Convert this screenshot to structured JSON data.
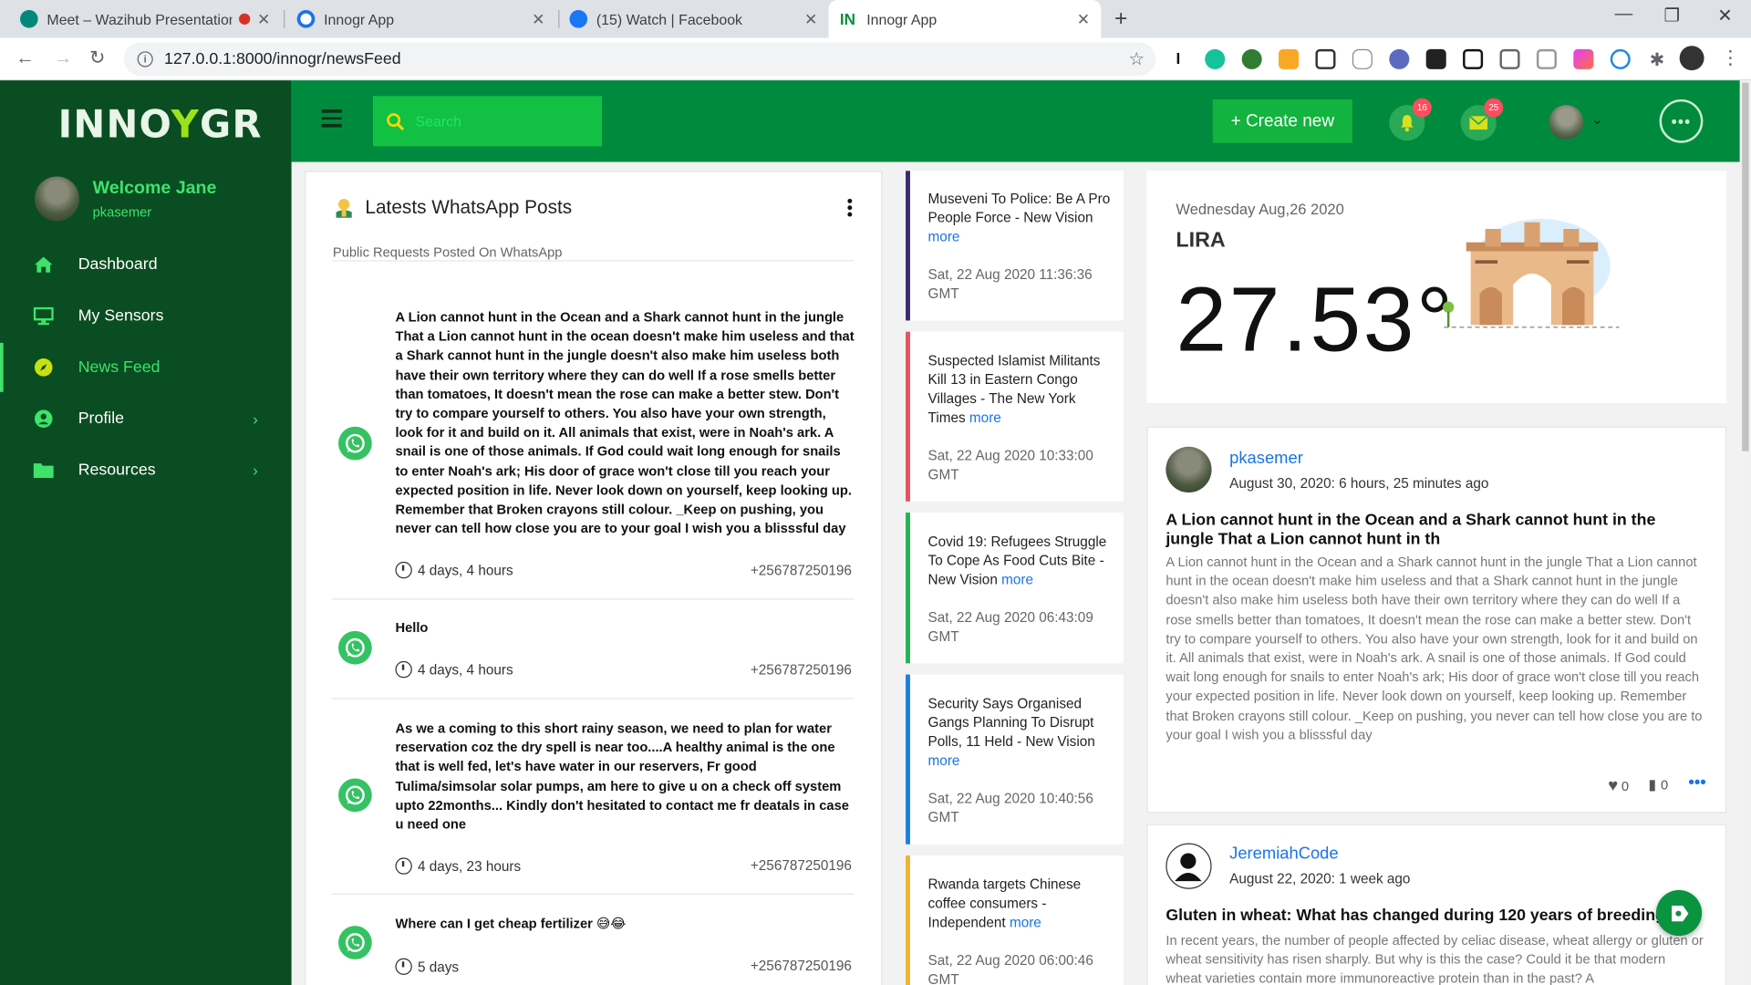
{
  "browser": {
    "tabs": [
      {
        "title": "Meet – Wazihub Presentation",
        "active": false
      },
      {
        "title": "Innogr App",
        "active": false
      },
      {
        "title": "(15) Watch | Facebook",
        "active": false
      },
      {
        "title": "Innogr App",
        "active": true
      }
    ],
    "url": "127.0.0.1:8000/innogr/newsFeed"
  },
  "sidebar": {
    "logo_left": "INNO",
    "logo_y": "Y",
    "logo_right": "GR",
    "welcome": "Welcome Jane",
    "username": "pkasemer",
    "items": [
      {
        "label": "Dashboard",
        "icon": "home-icon"
      },
      {
        "label": "My Sensors",
        "icon": "monitor-icon"
      },
      {
        "label": "News Feed",
        "icon": "compass-icon",
        "active": true
      },
      {
        "label": "Profile",
        "icon": "user-circle-icon",
        "expandable": true
      },
      {
        "label": "Resources",
        "icon": "folder-icon",
        "expandable": true
      }
    ]
  },
  "topbar": {
    "search_placeholder": "Search",
    "create_label": "+ Create new",
    "notifications_count": "16",
    "messages_count": "25"
  },
  "whatsapp": {
    "title": "Latests WhatsApp Posts",
    "subtitle": "Public Requests Posted On WhatsApp",
    "posts": [
      {
        "text": "A Lion cannot hunt in the Ocean and a Shark cannot hunt in the jungle That a Lion cannot hunt in the ocean doesn't make him useless and that a Shark cannot hunt in the jungle doesn't also make him useless both have their own territory where they can do well If a rose smells better than tomatoes, It doesn't mean the rose can make a better stew. Don't try to compare yourself to others. You also have your own strength, look for it and build on it. All animals that exist, were in Noah's ark. A snail is one of those animals. If God could wait long enough for snails to enter Noah's ark; His door of grace won't close till you reach your expected position in life. Never look down on yourself, keep looking up. Remember that Broken crayons still colour. _Keep on pushing, you never can tell how close you are to your goal I wish you a blisssful day",
        "time": "4 days, 4 hours",
        "phone": "+256787250196"
      },
      {
        "text": "Hello",
        "time": "4 days, 4 hours",
        "phone": "+256787250196"
      },
      {
        "text": "As we a coming to this short rainy season, we need to plan for water reservation coz the dry spell is near too....A healthy animal is the one that is well fed, let's have water in our reservers, Fr good Tulima/simsolar solar pumps, am here to give u on a check off system upto 22months... Kindly don't hesitated to contact me fr deatals in case u need one",
        "time": "4 days, 23 hours",
        "phone": "+256787250196"
      },
      {
        "text": "Where can I get cheap fertilizer 😅😂",
        "time": "5 days",
        "phone": "+256787250196"
      }
    ]
  },
  "news": [
    {
      "title": "Museveni To Police: Be A Pro People Force - New Vision",
      "more": "more",
      "date": "Sat, 22 Aug 2020 11:36:36 GMT",
      "color": "#3b2a6e"
    },
    {
      "title": "Suspected Islamist Militants Kill 13 in Eastern Congo Villages - The New York Times",
      "more": "more",
      "date": "Sat, 22 Aug 2020 10:33:00 GMT",
      "color": "#e8515f"
    },
    {
      "title": "Covid 19: Refugees Struggle To Cope As Food Cuts Bite - New Vision",
      "more": "more",
      "date": "Sat, 22 Aug 2020 06:43:09 GMT",
      "color": "#22b453"
    },
    {
      "title": "Security Says Organised Gangs Planning To Disrupt Polls, 11 Held - New Vision",
      "more": "more",
      "date": "Sat, 22 Aug 2020 10:40:56 GMT",
      "color": "#1a7fe0"
    },
    {
      "title": "Rwanda targets Chinese coffee consumers - Independent",
      "more": "more",
      "date": "Sat, 22 Aug 2020 06:00:46 GMT",
      "color": "#f2b233"
    }
  ],
  "weather": {
    "date": "Wednesday Aug,26 2020",
    "city": "LIRA",
    "temp": "27.53°"
  },
  "posts": [
    {
      "user": "pkasemer",
      "time": "August 30, 2020: 6 hours, 25 minutes ago",
      "headline": "A Lion cannot hunt in the Ocean and a Shark cannot hunt in the jungle That a Lion cannot hunt in th",
      "body": "A Lion cannot hunt in the Ocean and a Shark cannot hunt in the jungle That a Lion cannot hunt in the ocean doesn't make him useless and that a Shark cannot hunt in the jungle doesn't also make him useless both have their own territory where they can do well If a rose smells better than tomatoes, It doesn't mean the rose can make a better stew. Don't try to compare yourself to others. You also have your own strength, look for it and build on it. All animals that exist, were in Noah's ark. A snail is one of those animals. If God could wait long enough for snails to enter Noah's ark; His door of grace won't close till you reach your expected position in life. Never look down on yourself, keep looking up. Remember that Broken crayons still colour. _Keep on pushing, you never can tell how close you are to your goal I wish you a blisssful day",
      "likes": "0",
      "dislikes": "0"
    },
    {
      "user": "JeremiahCode",
      "time": "August 22, 2020: 1 week ago",
      "headline": "Gluten in wheat: What has changed during 120 years of breeding?",
      "body": "In recent years, the number of people affected by celiac disease, wheat allergy or gluten or wheat sensitivity has risen sharply. But why is this the case? Could it be that modern wheat varieties contain more immunoreactive protein than in the past? A"
    }
  ]
}
